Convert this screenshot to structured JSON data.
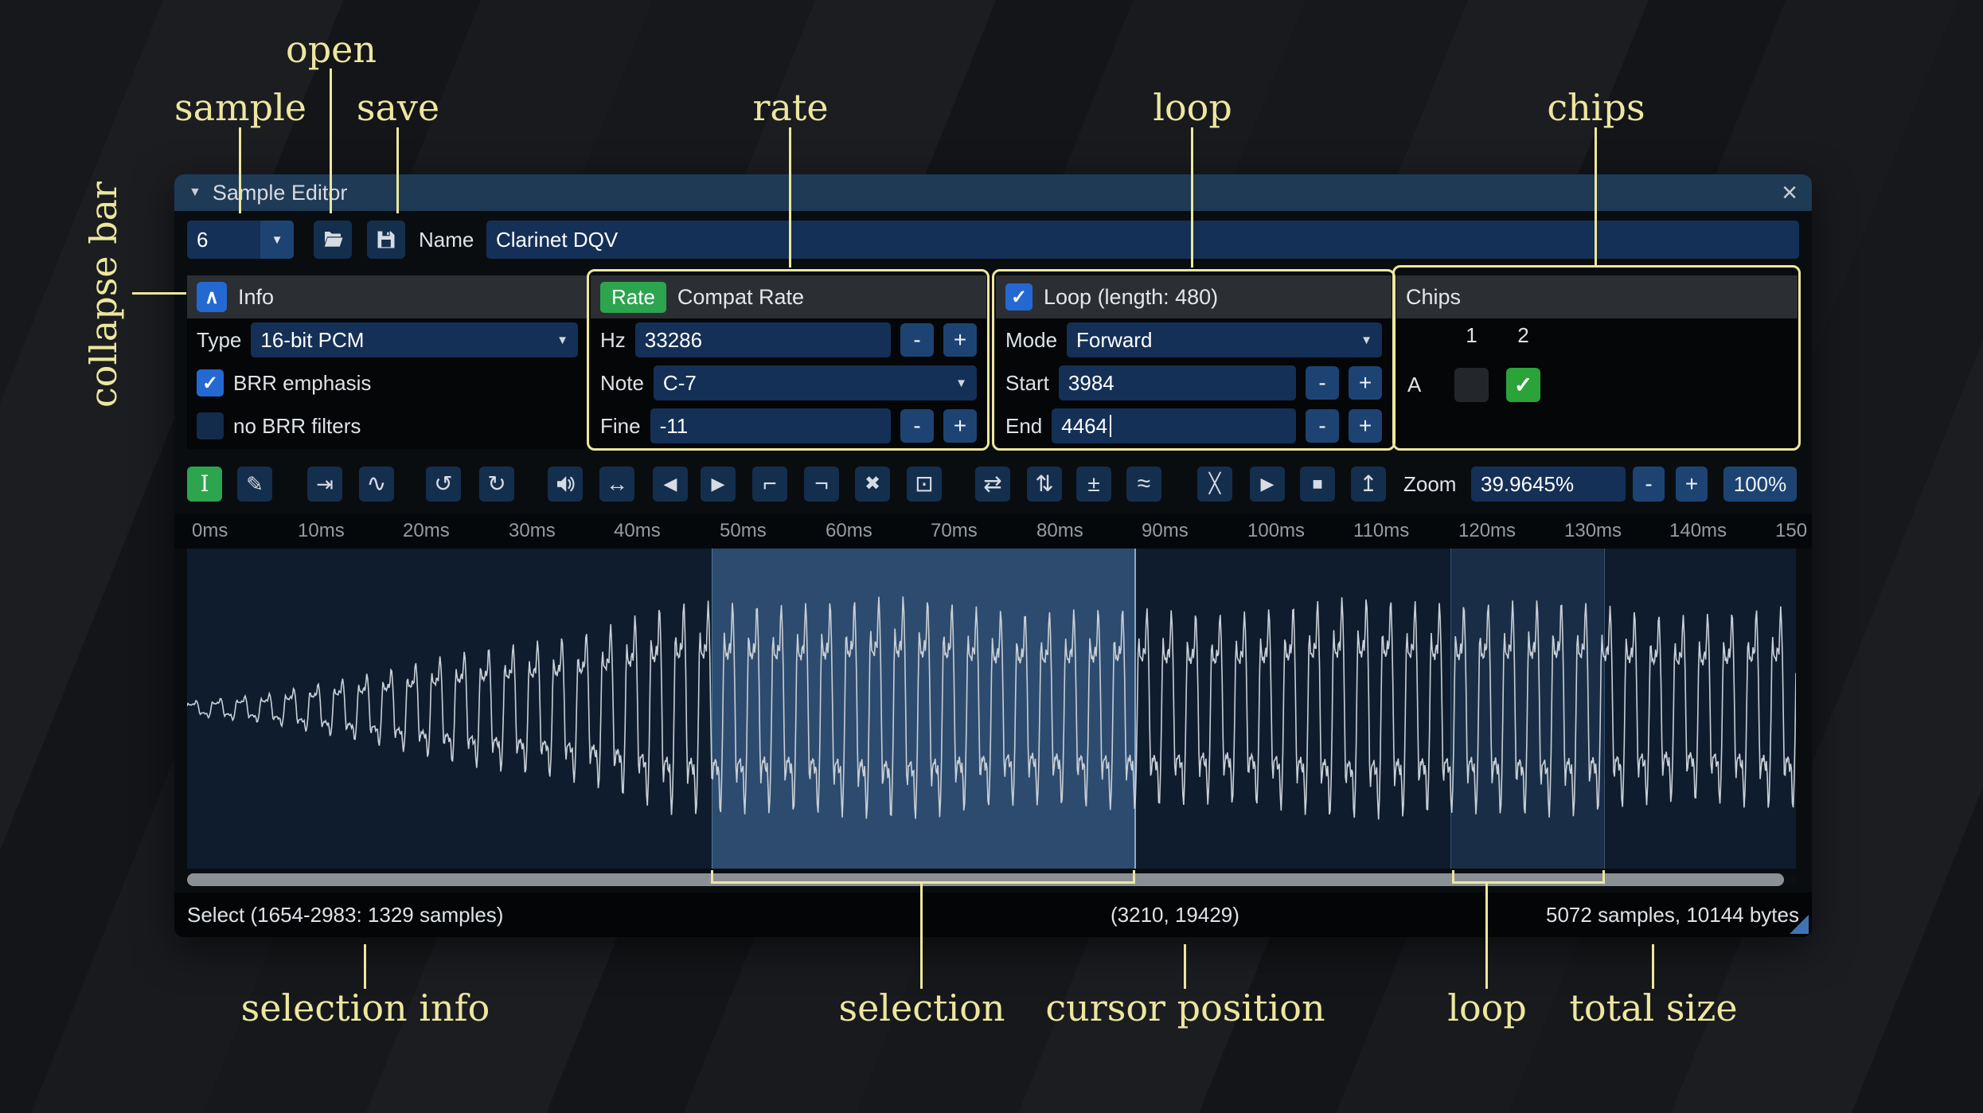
{
  "colors": {
    "annotation": "#ece79e",
    "accent_blue": "#2469d2",
    "accent_green": "#2da44e",
    "selection_fill": "#5a8cc9",
    "titlebar": "#1f3a55"
  },
  "annotations": {
    "open": "open",
    "sample": "sample",
    "save": "save",
    "rate": "rate",
    "loop": "loop",
    "chips": "chips",
    "collapse_bar": "collapse bar",
    "selection_info": "selection info",
    "selection": "selection",
    "cursor_position": "cursor position",
    "loop_bottom": "loop",
    "total_size": "total size"
  },
  "glyphs": {
    "dropdown": "▼",
    "check": "✓",
    "chevron_up": "∧",
    "window_collapse": "▼",
    "close": "×"
  },
  "controls": {
    "minus": "-",
    "plus": "+"
  },
  "window": {
    "title": "Sample Editor"
  },
  "sample_row": {
    "number": "6",
    "name_label": "Name",
    "name_value": "Clarinet DQV"
  },
  "info": {
    "header": "Info",
    "type_label": "Type",
    "type_value": "16-bit PCM",
    "brr_emphasis_label": "BRR emphasis",
    "no_brr_filters_label": "no BRR filters"
  },
  "rate": {
    "tag": "Rate",
    "header": "Compat Rate",
    "hz_label": "Hz",
    "hz_value": "33286",
    "note_label": "Note",
    "note_value": "C-7",
    "fine_label": "Fine",
    "fine_value": "-11"
  },
  "loop": {
    "header": "Loop (length: 480)",
    "mode_label": "Mode",
    "mode_value": "Forward",
    "start_label": "Start",
    "start_value": "3984",
    "end_label": "End",
    "end_value": "4464"
  },
  "chips": {
    "header": "Chips",
    "col_1": "1",
    "col_2": "2",
    "row_a": "A"
  },
  "toolbar": {
    "zoom_label": "Zoom",
    "zoom_value": "39.9645%",
    "zoom_reset": "100%",
    "icons": [
      {
        "name": "select-tool",
        "glyph": "I"
      },
      {
        "name": "draw-tool",
        "glyph": "✎"
      },
      {
        "name": "resize",
        "glyph": "⇥"
      },
      {
        "name": "resample",
        "glyph": "∿"
      },
      {
        "name": "undo",
        "glyph": "↺"
      },
      {
        "name": "redo",
        "glyph": "↻"
      },
      {
        "name": "amplify"
      },
      {
        "name": "normalize",
        "glyph": "↔"
      },
      {
        "name": "fade-in",
        "glyph": "◀"
      },
      {
        "name": "fade-out",
        "glyph": "▶"
      },
      {
        "name": "insert-silence",
        "glyph": "⌐"
      },
      {
        "name": "apply-silence",
        "glyph": "¬"
      },
      {
        "name": "delete",
        "glyph": "✖"
      },
      {
        "name": "trim",
        "glyph": "⊡"
      },
      {
        "name": "reverse",
        "glyph": "⇄"
      },
      {
        "name": "invert",
        "glyph": "⇅"
      },
      {
        "name": "sign",
        "glyph": "±"
      },
      {
        "name": "filter",
        "glyph": "≈"
      },
      {
        "name": "crossfade",
        "glyph": "╳"
      },
      {
        "name": "preview",
        "glyph": "▶"
      },
      {
        "name": "stop-preview",
        "glyph": "■"
      },
      {
        "name": "create-wavetable",
        "glyph": "↥"
      }
    ]
  },
  "timeline": {
    "labels": [
      "0ms",
      "10ms",
      "20ms",
      "30ms",
      "40ms",
      "50ms",
      "60ms",
      "70ms",
      "80ms",
      "90ms",
      "100ms",
      "110ms",
      "120ms",
      "130ms",
      "140ms",
      "150"
    ]
  },
  "status": {
    "selection_info": "Select (1654-2983: 1329 samples)",
    "cursor_position": "(3210, 19429)",
    "total_size": "5072 samples, 10144 bytes"
  }
}
